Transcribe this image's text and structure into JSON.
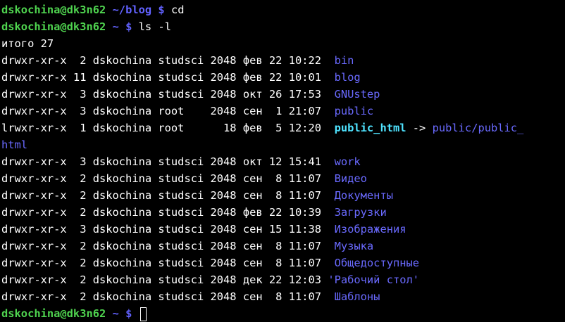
{
  "prompts": [
    {
      "user": "dskochina@dk3n62",
      "path": " ~/blog",
      "symbol": " $ ",
      "command": "cd"
    },
    {
      "user": "dskochina@dk3n62",
      "path": " ~",
      "symbol": " $ ",
      "command": "ls -l"
    }
  ],
  "total": "итого 27",
  "entries": [
    {
      "meta": "drwxr-xr-x  2 dskochina studsci 2048 фев 22 10:22  ",
      "name": "bin"
    },
    {
      "meta": "drwxr-xr-x 11 dskochina studsci 2048 фев 22 10:01  ",
      "name": "blog"
    },
    {
      "meta": "drwxr-xr-x  3 dskochina studsci 2048 окт 26 17:53  ",
      "name": "GNUstep"
    },
    {
      "meta": "drwxr-xr-x  3 dskochina root    2048 сен  1 21:07  ",
      "name": "public"
    },
    {
      "meta": "lrwxr-xr-x  1 dskochina root      18 фев  5 12:20  ",
      "name": "public_html",
      "arrow": " -> ",
      "target": "public/public_",
      "wrap": "html"
    },
    {
      "meta": "drwxr-xr-x  3 dskochina studsci 2048 окт 12 15:41  ",
      "name": "work"
    },
    {
      "meta": "drwxr-xr-x  2 dskochina studsci 2048 сен  8 11:07  ",
      "name": "Видео"
    },
    {
      "meta": "drwxr-xr-x  2 dskochina studsci 2048 сен  8 11:07  ",
      "name": "Документы"
    },
    {
      "meta": "drwxr-xr-x  2 dskochina studsci 2048 фев 22 10:39  ",
      "name": "Загрузки"
    },
    {
      "meta": "drwxr-xr-x  3 dskochina studsci 2048 сен 15 11:38  ",
      "name": "Изображения"
    },
    {
      "meta": "drwxr-xr-x  2 dskochina studsci 2048 сен  8 11:07  ",
      "name": "Музыка"
    },
    {
      "meta": "drwxr-xr-x  2 dskochina studsci 2048 сен  8 11:07  ",
      "name": "Общедоступные"
    },
    {
      "meta": "drwxr-xr-x  2 dskochina studsci 2048 дек 22 12:03 ",
      "name": "'Рабочий стол'"
    },
    {
      "meta": "drwxr-xr-x  2 dskochina studsci 2048 сен  8 11:07  ",
      "name": "Шаблоны"
    }
  ],
  "final_prompt": {
    "user": "dskochina@dk3n62",
    "path": " ~",
    "symbol": " $ "
  },
  "colors": {
    "prompt_user": "#4fd34f",
    "prompt_path": "#6262ff",
    "directory": "#6a6aff",
    "symlink": "#4fe3ff",
    "background": "#000000"
  }
}
